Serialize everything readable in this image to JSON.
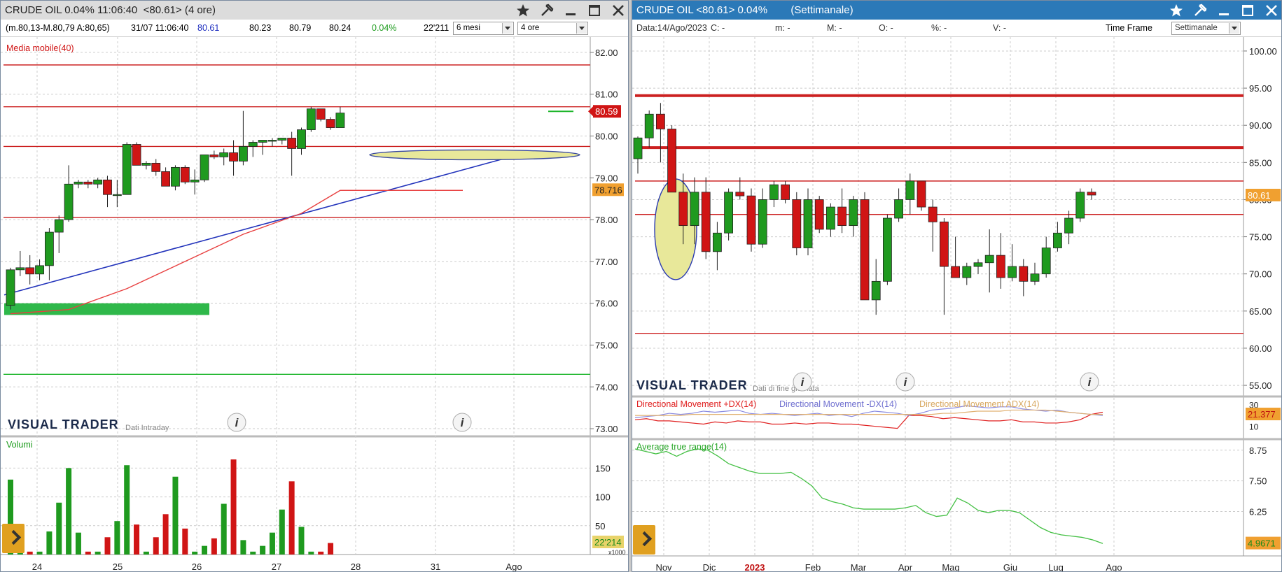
{
  "left_window": {
    "title": "CRUDE OIL 0.04% 11:06:40  <80.61> (4 ore)",
    "infobar": {
      "range": "(m.80,13-M.80,79 A:80,65)",
      "datetime": "31/07 11:06:40",
      "last": "80.61",
      "v1": "80.23",
      "v2": "80.79",
      "v3": "80.24",
      "change": "0.04%",
      "volume": "22'211"
    },
    "period_select": "6 mesi",
    "interval_select": "4 ore",
    "indicator_label": "Media mobile(40)",
    "watermark": "VISUAL TRADER",
    "watermark_sub": "Dati Intraday",
    "volume_label": "Volumi",
    "price_ticks": [
      "82.00",
      "81.00",
      "80.00",
      "79.00",
      "78.00",
      "77.00",
      "76.00",
      "75.00",
      "74.00",
      "73.00"
    ],
    "price_badge": "80.59",
    "ma_badge": "78.716",
    "volume_ticks": [
      "150",
      "100",
      "50"
    ],
    "volume_badge": "22'214",
    "volume_unit": "x1000",
    "x_labels": [
      "24",
      "25",
      "26",
      "27",
      "28",
      "31",
      "Ago"
    ]
  },
  "right_window": {
    "title": "CRUDE OIL <80.61> 0.04%        (Settimanale)",
    "infobar": {
      "data": "Data:14/Ago/2023",
      "c": "C: -",
      "m": "m: -",
      "M": "M: -",
      "O": "O: -",
      "pct": "%: -",
      "V": "V: -",
      "tf_label": "Time Frame"
    },
    "tf_select": "Settimanale",
    "watermark": "VISUAL TRADER",
    "watermark_sub": "Dati di fine giornata",
    "price_ticks": [
      "100.00",
      "95.00",
      "90.00",
      "85.00",
      "80.00",
      "75.00",
      "70.00",
      "65.00",
      "60.00",
      "55.00"
    ],
    "price_badge": "80.61",
    "dmi_labels": {
      "plus": "Directional Movement +DX(14)",
      "minus": "Directional Movement -DX(14)",
      "adx": "Directional Movement ADX(14)"
    },
    "dmi_ticks": [
      "30",
      "20",
      "10"
    ],
    "dmi_badge": "21.377",
    "atr_label": "Average true range(14)",
    "atr_ticks": [
      "8.75",
      "7.50",
      "6.25"
    ],
    "atr_badge": "4.9671",
    "x_labels": [
      "Nov",
      "Dic",
      "2023",
      "Feb",
      "Mar",
      "Apr",
      "Mag",
      "Giu",
      "Lug",
      "Ago"
    ]
  },
  "colors": {
    "up": "#1f9a1f",
    "down": "#d01515",
    "grid": "#cccccc",
    "right_title_bg": "#2b79b8",
    "left_title_bg": "#dcdcdc",
    "hline": "#cc2020",
    "ma": "#e84040",
    "trend": "#2233bb",
    "zone": "#e8e89a",
    "badge_orange": "#f0a030",
    "green_zone": "#2fb84a"
  },
  "chart_data": [
    {
      "type": "candlestick",
      "timeframe": "4 ore",
      "x": [
        "24",
        "24",
        "24",
        "24",
        "24",
        "24",
        "25",
        "25",
        "25",
        "25",
        "25",
        "25",
        "26",
        "26",
        "26",
        "26",
        "26",
        "26",
        "27",
        "27",
        "27",
        "27",
        "27",
        "27",
        "28",
        "28",
        "28",
        "28",
        "28",
        "28",
        "31",
        "31",
        "31",
        "31",
        "31"
      ],
      "ohlc": [
        [
          75.95,
          76.85,
          75.85,
          76.8
        ],
        [
          76.8,
          77.25,
          76.65,
          76.85
        ],
        [
          76.85,
          77.15,
          76.45,
          76.7
        ],
        [
          76.7,
          77.05,
          76.55,
          76.9
        ],
        [
          76.9,
          77.8,
          76.55,
          77.7
        ],
        [
          77.7,
          78.1,
          77.2,
          78.0
        ],
        [
          78.0,
          79.3,
          77.95,
          78.85
        ],
        [
          78.85,
          78.95,
          78.75,
          78.9
        ],
        [
          78.9,
          78.95,
          78.75,
          78.85
        ],
        [
          78.85,
          79.0,
          78.75,
          78.95
        ],
        [
          78.95,
          79.05,
          78.3,
          78.6
        ],
        [
          78.6,
          78.95,
          78.3,
          78.6
        ],
        [
          78.6,
          79.85,
          78.6,
          79.8
        ],
        [
          79.8,
          79.85,
          79.3,
          79.3
        ],
        [
          79.3,
          79.4,
          79.2,
          79.35
        ],
        [
          79.35,
          79.45,
          79.05,
          79.15
        ],
        [
          79.15,
          79.25,
          78.8,
          78.8
        ],
        [
          78.8,
          79.3,
          78.7,
          79.25
        ],
        [
          79.25,
          79.3,
          78.85,
          78.9
        ],
        [
          78.9,
          79.2,
          78.6,
          78.95
        ],
        [
          78.95,
          79.55,
          78.9,
          79.55
        ],
        [
          79.55,
          79.65,
          79.45,
          79.5
        ],
        [
          79.5,
          79.7,
          79.3,
          79.6
        ],
        [
          79.6,
          79.9,
          79.05,
          79.4
        ],
        [
          79.4,
          80.6,
          79.3,
          79.75
        ],
        [
          79.75,
          79.9,
          79.5,
          79.85
        ],
        [
          79.85,
          79.9,
          79.55,
          79.9
        ],
        [
          79.9,
          79.95,
          79.75,
          79.9
        ],
        [
          79.9,
          79.95,
          79.8,
          79.95
        ],
        [
          79.95,
          80.1,
          79.05,
          79.7
        ],
        [
          79.7,
          80.2,
          79.55,
          80.15
        ],
        [
          80.15,
          80.7,
          80.1,
          80.65
        ],
        [
          80.65,
          80.65,
          80.35,
          80.4
        ],
        [
          80.4,
          80.45,
          80.15,
          80.2
        ],
        [
          80.2,
          80.7,
          80.2,
          80.55
        ]
      ],
      "volume": [
        130,
        30,
        5,
        5,
        40,
        90,
        150,
        38,
        5,
        5,
        30,
        58,
        155,
        52,
        5,
        30,
        70,
        135,
        45,
        5,
        15,
        28,
        88,
        165,
        25,
        5,
        15,
        38,
        78,
        127,
        48,
        5,
        5,
        20,
        0
      ],
      "moving_average_40": [
        [
          0,
          75.75
        ],
        [
          6,
          75.85
        ],
        [
          12,
          76.35
        ],
        [
          18,
          77.0
        ],
        [
          24,
          77.65
        ],
        [
          30,
          78.15
        ],
        [
          34,
          78.7
        ]
      ],
      "horizontal_lines": [
        81.7,
        80.7,
        79.75,
        78.05,
        74.3
      ],
      "ylim": [
        72.75,
        82.3
      ],
      "volume_ylim": [
        0,
        165
      ]
    },
    {
      "type": "candlestick",
      "timeframe": "Settimanale",
      "x": [
        "Nov",
        "Dic",
        "2023",
        "Feb",
        "Mar",
        "Apr",
        "Mag",
        "Giu",
        "Lug",
        "Ago"
      ],
      "ohlc": [
        [
          85.5,
          88.5,
          83.5,
          88.3
        ],
        [
          88.3,
          92.0,
          87.0,
          91.5
        ],
        [
          91.5,
          93.0,
          85.0,
          89.5
        ],
        [
          89.5,
          90.0,
          81.0,
          81.0
        ],
        [
          81.0,
          83.5,
          74.0,
          76.5
        ],
        [
          76.5,
          83.0,
          74.0,
          81.0
        ],
        [
          81.0,
          83.0,
          72.0,
          73.0
        ],
        [
          73.0,
          77.0,
          70.5,
          75.5
        ],
        [
          75.5,
          81.5,
          74.5,
          81.0
        ],
        [
          81.0,
          83.0,
          80.0,
          80.5
        ],
        [
          80.5,
          81.5,
          73.0,
          74.0
        ],
        [
          74.0,
          81.5,
          73.5,
          80.0
        ],
        [
          80.0,
          82.5,
          79.0,
          82.0
        ],
        [
          82.0,
          82.5,
          79.5,
          80.0
        ],
        [
          80.0,
          81.0,
          72.5,
          73.5
        ],
        [
          73.5,
          81.5,
          72.5,
          80.0
        ],
        [
          80.0,
          80.5,
          75.5,
          76.0
        ],
        [
          76.0,
          79.5,
          75.0,
          79.0
        ],
        [
          79.0,
          81.5,
          75.5,
          76.5
        ],
        [
          76.5,
          80.5,
          75.0,
          80.0
        ],
        [
          80.0,
          81.0,
          71.5,
          66.5
        ],
        [
          66.5,
          72.0,
          64.5,
          69.0
        ],
        [
          69.0,
          78.0,
          68.5,
          77.5
        ],
        [
          77.5,
          81.5,
          77.0,
          80.0
        ],
        [
          80.0,
          83.5,
          78.0,
          82.5
        ],
        [
          82.5,
          82.5,
          78.5,
          79.0
        ],
        [
          79.0,
          80.0,
          73.0,
          77.0
        ],
        [
          77.0,
          77.5,
          64.5,
          71.0
        ],
        [
          71.0,
          75.0,
          69.5,
          69.5
        ],
        [
          69.5,
          71.5,
          68.5,
          71.0
        ],
        [
          71.0,
          72.0,
          70.0,
          71.5
        ],
        [
          71.5,
          76.0,
          67.5,
          72.5
        ],
        [
          72.5,
          75.5,
          68.0,
          69.5
        ],
        [
          69.5,
          74.0,
          69.0,
          71.0
        ],
        [
          71.0,
          72.0,
          67.0,
          69.0
        ],
        [
          69.0,
          71.5,
          68.5,
          70.0
        ],
        [
          70.0,
          75.0,
          69.5,
          73.5
        ],
        [
          73.5,
          77.0,
          73.0,
          75.5
        ],
        [
          75.5,
          78.5,
          74.0,
          77.5
        ],
        [
          77.5,
          81.5,
          77.0,
          81.0
        ],
        [
          81.0,
          81.5,
          80.0,
          80.61
        ]
      ],
      "horizontal_lines": [
        94.0,
        87.0,
        82.5,
        78.0,
        62.0
      ],
      "ylim": [
        53.5,
        101.5
      ]
    },
    {
      "type": "line",
      "name": "DMI(14)",
      "ylim": [
        0,
        35
      ],
      "series": [
        {
          "name": "Directional Movement +DX(14)",
          "values": [
            16,
            17,
            15,
            15,
            14,
            13,
            12,
            14,
            13,
            15,
            14,
            14,
            12,
            12,
            13,
            12,
            13,
            13,
            12,
            12,
            11,
            10,
            9,
            8,
            20,
            20,
            19,
            17,
            18,
            17,
            16,
            15,
            15,
            16,
            14,
            14,
            13,
            13,
            14,
            16,
            21,
            23
          ]
        },
        {
          "name": "Directional Movement -DX(14)",
          "values": [
            18,
            19,
            20,
            22,
            21,
            22,
            24,
            23,
            24,
            25,
            22,
            21,
            22,
            21,
            20,
            21,
            22,
            20,
            21,
            19,
            22,
            24,
            23,
            22,
            20,
            22,
            25,
            26,
            27,
            29,
            28,
            27,
            28,
            28,
            26,
            25,
            24,
            25,
            23,
            22,
            21,
            20
          ]
        },
        {
          "name": "Directional Movement ADX(14)",
          "values": [
            20,
            20,
            20,
            20,
            20,
            21,
            21,
            21,
            21,
            21,
            21,
            21,
            21,
            21,
            21,
            21,
            21,
            21,
            21,
            21,
            21,
            21,
            21,
            21,
            21,
            21,
            21,
            22,
            22,
            23,
            24,
            24,
            24,
            25,
            25,
            25,
            25,
            24,
            23,
            22,
            21,
            21
          ]
        }
      ]
    },
    {
      "type": "line",
      "name": "Average true range(14)",
      "ylim": [
        4.5,
        9.0
      ],
      "series": [
        {
          "name": "Average true range(14)",
          "values": [
            8.8,
            8.7,
            8.6,
            8.7,
            8.5,
            8.7,
            8.8,
            8.75,
            8.5,
            8.2,
            8.05,
            7.9,
            7.8,
            7.8,
            7.8,
            7.85,
            7.6,
            7.3,
            6.8,
            6.65,
            6.55,
            6.4,
            6.35,
            6.35,
            6.35,
            6.35,
            6.4,
            6.5,
            6.2,
            6.05,
            6.1,
            6.8,
            6.6,
            6.3,
            6.2,
            6.3,
            6.3,
            6.2,
            5.9,
            5.6,
            5.4,
            5.3,
            5.25,
            5.2,
            5.1,
            4.95
          ]
        }
      ]
    }
  ]
}
